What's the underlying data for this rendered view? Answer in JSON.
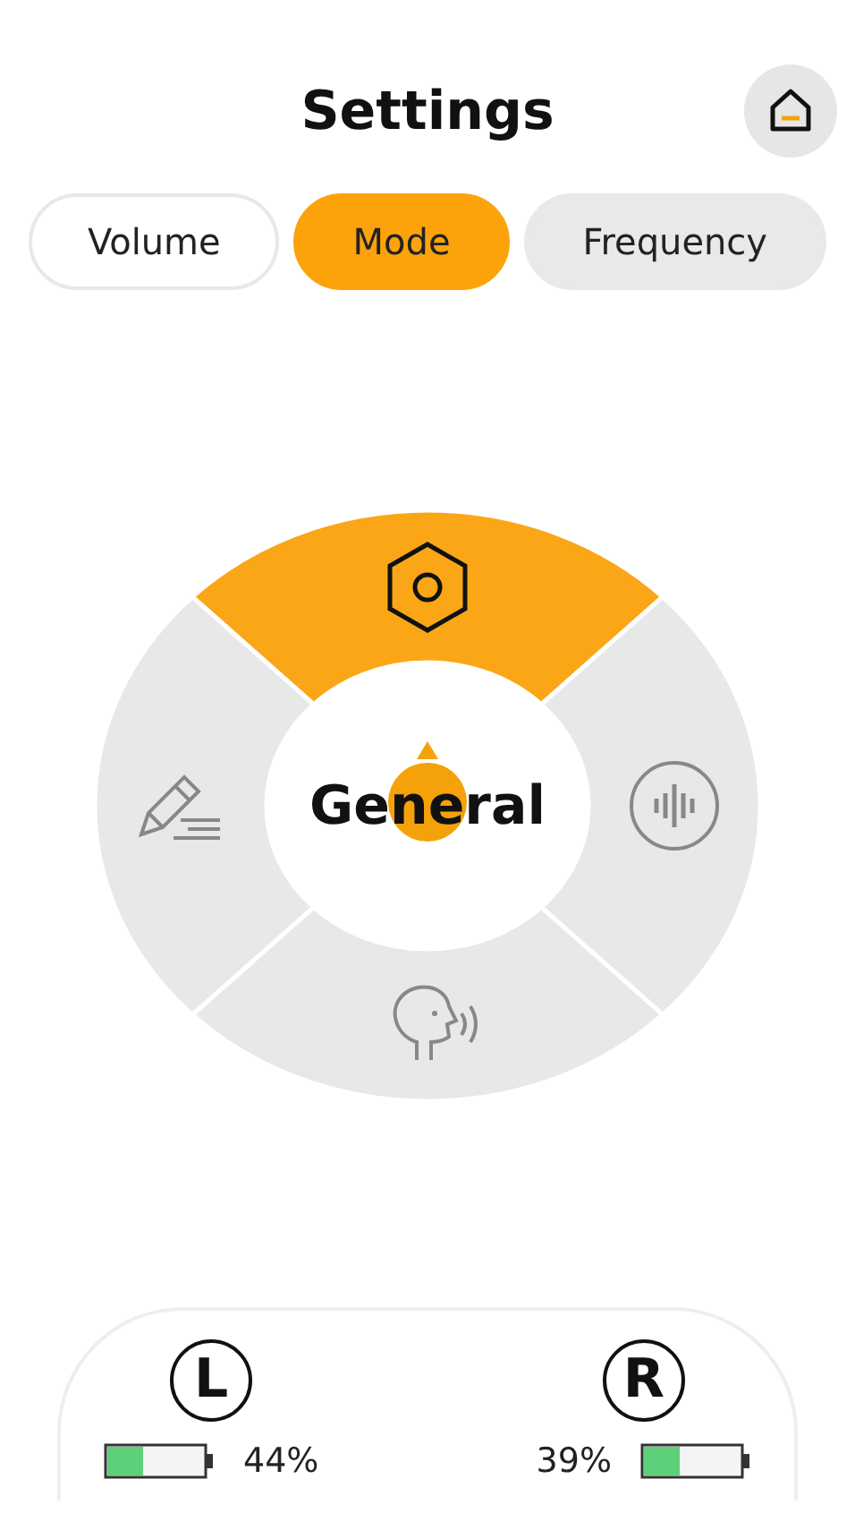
{
  "header": {
    "title": "Settings"
  },
  "tabs": [
    {
      "label": "Volume",
      "selected": false
    },
    {
      "label": "Mode",
      "selected": true
    },
    {
      "label": "Frequency",
      "selected": false
    }
  ],
  "mode_wheel": {
    "current": "General",
    "segments": [
      {
        "kind": "general",
        "selected": true
      },
      {
        "kind": "sound",
        "selected": false
      },
      {
        "kind": "speech",
        "selected": false
      },
      {
        "kind": "custom",
        "selected": false
      }
    ]
  },
  "battery": [
    {
      "side": "L",
      "reading": "44%"
    },
    {
      "side": "R",
      "reading": "39%"
    }
  ]
}
